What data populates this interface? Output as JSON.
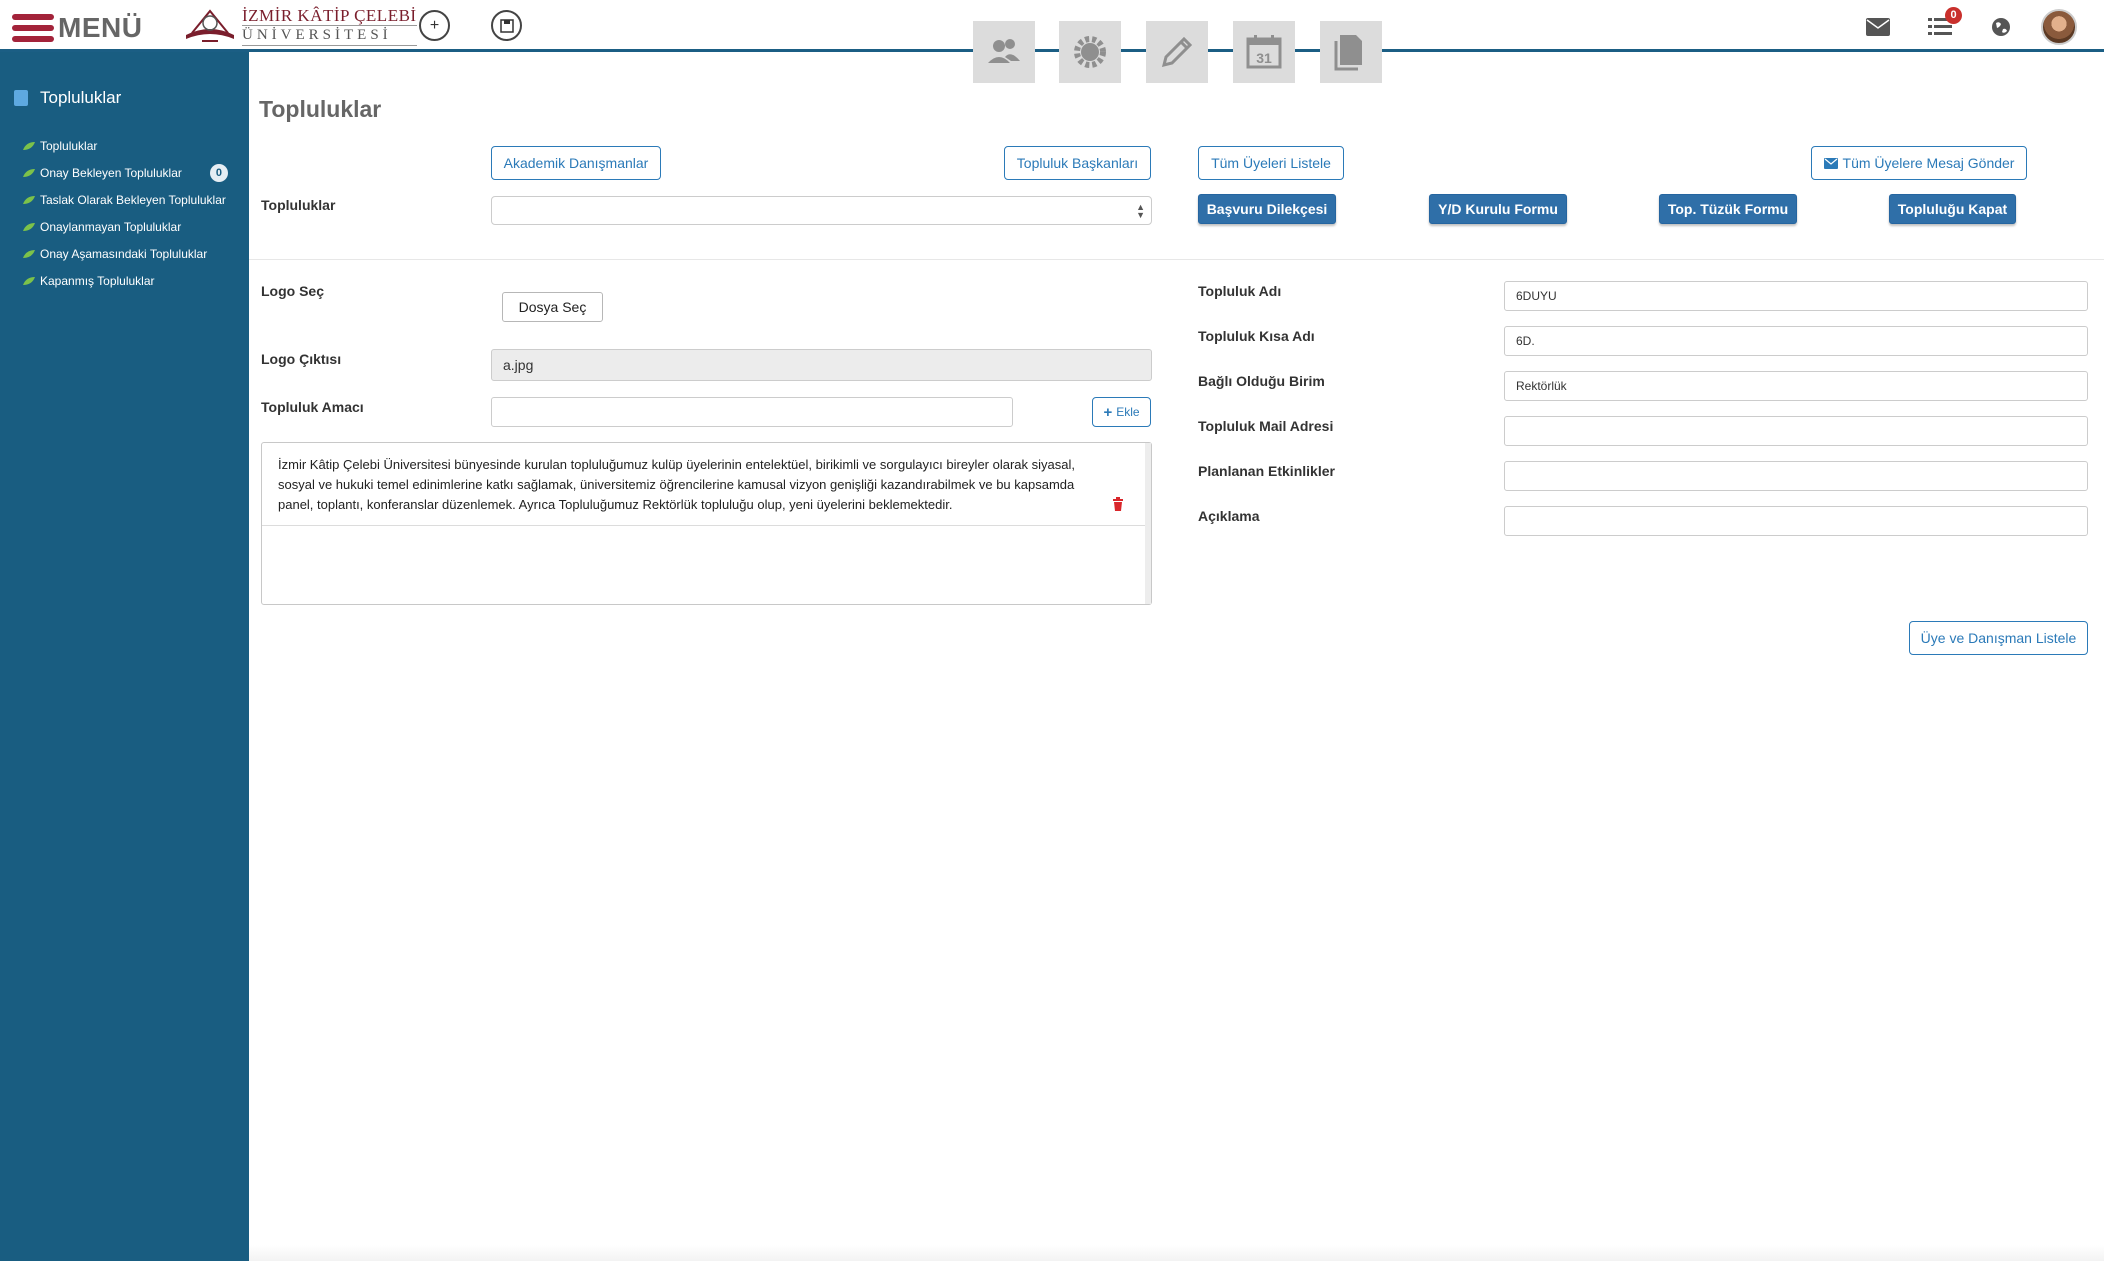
{
  "topbar": {
    "menu_label": "MENÜ",
    "logo_line1": "İZMİR KÂTİP ÇELEBİ",
    "logo_line2": "ÜNİVERSİTESİ",
    "add_icon": "plus-circle-icon",
    "save_icon": "save-circle-icon",
    "tiles": [
      "users-icon",
      "gear-icon",
      "pencil-icon",
      "calendar-icon",
      "documents-icon"
    ],
    "calendar_number": "31",
    "notification_count": "0",
    "right_icons": [
      "envelope-icon",
      "list-icon",
      "globe-icon",
      "avatar"
    ]
  },
  "sidebar": {
    "title": "Topluluklar",
    "items": [
      {
        "label": "Topluluklar"
      },
      {
        "label": "Onay Bekleyen Topluluklar",
        "badge": "0"
      },
      {
        "label": "Taslak Olarak Bekleyen Topluluklar"
      },
      {
        "label": "Onaylanmayan Topluluklar"
      },
      {
        "label": "Onay Aşamasındaki Topluluklar"
      },
      {
        "label": "Kapanmış Topluluklar"
      }
    ]
  },
  "main": {
    "title": "Topluluklar",
    "buttons": {
      "advisors": "Akademik Danışmanlar",
      "presidents": "Topluluk Başkanları",
      "list_members": "Tüm Üyeleri Listele",
      "message_all": "Tüm Üyelere Mesaj Gönder",
      "application": "Başvuru Dilekçesi",
      "board_form": "Y/D Kurulu Formu",
      "bylaws_form": "Top. Tüzük Formu",
      "close_community": "Topluluğu Kapat",
      "choose_file": "Dosya Seç",
      "add": "Ekle",
      "list_members_advisors": "Üye ve Danışman Listele"
    },
    "labels": {
      "communities": "Topluluklar",
      "logo_select": "Logo Seç",
      "logo_output": "Logo Çıktısı",
      "community_purpose": "Topluluk Amacı",
      "community_name": "Topluluk Adı",
      "short_name": "Topluluk Kısa Adı",
      "affiliated_unit": "Bağlı Olduğu Birim",
      "mail_address": "Topluluk Mail Adresi",
      "planned_events": "Planlanan Etkinlikler",
      "description": "Açıklama"
    },
    "values": {
      "communities_select": "",
      "logo_output": "a.jpg",
      "purpose_input": "",
      "community_name": "6DUYU",
      "short_name": "6D.",
      "affiliated_unit": "Rektörlük",
      "mail_address": "",
      "planned_events": "",
      "description": ""
    },
    "purpose_entries": [
      "İzmir Kâtip Çelebi Üniversitesi bünyesinde kurulan topluluğumuz kulüp üyelerinin entelektüel, birikimli ve sorgulayıcı bireyler olarak siyasal, sosyal ve hukuki temel edinimlerine katkı sağlamak, üniversitemiz öğrencilerine kamusal vizyon genişliği kazandırabilmek ve bu kapsamda panel, toplantı, konferanslar düzenlemek. Ayrıca Topluluğumuz Rektörlük topluluğu olup, yeni üyelerini beklemektedir."
    ]
  },
  "colors": {
    "sidebar_bg": "#195d81",
    "accent_blue": "#2b7ab8",
    "solid_button": "#2f6fa8",
    "brand_red": "#a3233a",
    "badge_red": "#c9302c"
  }
}
